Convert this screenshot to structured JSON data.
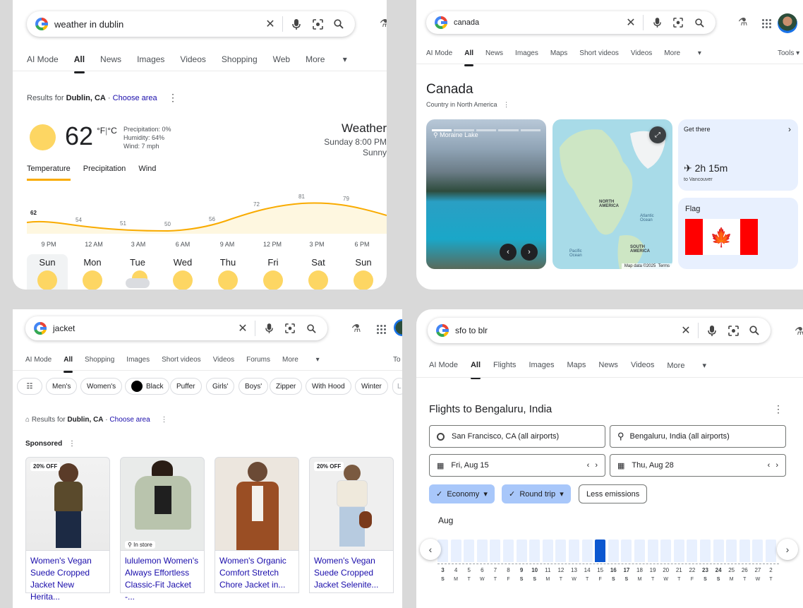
{
  "common": {
    "ai_mode": "AI Mode",
    "all": "All",
    "more": "More",
    "results_for": "Results for",
    "choose_area": "Choose area"
  },
  "weather": {
    "query": "weather in dublin",
    "tabs": [
      "News",
      "Images",
      "Videos",
      "Shopping",
      "Web"
    ],
    "location": "Dublin, CA",
    "temp": "62",
    "unit_f": "°F",
    "unit_sep": "|",
    "unit_c": "°C",
    "precipitation": "Precipitation: 0%",
    "humidity": "Humidity: 64%",
    "wind": "Wind: 7 mph",
    "heading": "Weather",
    "datetime": "Sunday 8:00 PM",
    "condition": "Sunny",
    "subtabs": [
      "Temperature",
      "Precipitation",
      "Wind"
    ],
    "hourly_temps": [
      "62",
      "54",
      "51",
      "50",
      "56",
      "72",
      "81",
      "79"
    ],
    "hours": [
      "9 PM",
      "12 AM",
      "3 AM",
      "6 AM",
      "9 AM",
      "12 PM",
      "3 PM",
      "6 PM"
    ],
    "days": [
      "Sun",
      "Mon",
      "Tue",
      "Wed",
      "Thu",
      "Fri",
      "Sat",
      "Sun"
    ],
    "colors": {
      "sun": "#fdd663",
      "line": "#f9ab00",
      "fill": "#fef7e0"
    }
  },
  "canada": {
    "query": "canada",
    "tabs": [
      "News",
      "Images",
      "Maps",
      "Short videos",
      "Videos"
    ],
    "tools": "Tools",
    "title": "Canada",
    "subtitle": "Country in North America",
    "photo_caption": "Moraine Lake",
    "map_labels": {
      "north_america": "NORTH AMERICA",
      "atlantic": "Atlantic Ocean",
      "pacific": "Pacific Ocean",
      "south_america": "SOUTH AMERICA",
      "map_data": "Map data ©2025",
      "terms": "Terms"
    },
    "get_there": "Get there",
    "flight_time": "2h 15m",
    "flight_dest": "to Vancouver",
    "flag_label": "Flag"
  },
  "jacket": {
    "query": "jacket",
    "tabs": [
      "Shopping",
      "Images",
      "Short videos",
      "Videos",
      "Forums"
    ],
    "tools_partial": "To",
    "chips": [
      "Men's",
      "Women's",
      "Black",
      "Puffer",
      "Girls'",
      "Boys'",
      "Zipper",
      "With Hood",
      "Winter",
      "L"
    ],
    "sponsored": "Sponsored",
    "products": [
      {
        "badge": "20% OFF",
        "title": "Women's Vegan Suede Cropped Jacket New Herita...",
        "store": ""
      },
      {
        "badge": "",
        "title": "lululemon Women's Always Effortless Classic-Fit Jacket -...",
        "store": "In store"
      },
      {
        "badge": "",
        "title": "Women's Organic Comfort Stretch Chore Jacket in...",
        "store": ""
      },
      {
        "badge": "20% OFF",
        "title": "Women's Vegan Suede Cropped Jacket Selenite...",
        "store": ""
      }
    ]
  },
  "flights": {
    "query": "sfo to blr",
    "tabs": [
      "Flights",
      "Images",
      "Maps",
      "News",
      "Videos"
    ],
    "title": "Flights to Bengaluru, India",
    "origin": "San Francisco, CA (all airports)",
    "destination": "Bengaluru, India (all airports)",
    "depart": "Fri, Aug 15",
    "return": "Thu, Aug 28",
    "economy": "Economy",
    "round_trip": "Round trip",
    "less_emissions": "Less emissions",
    "month": "Aug",
    "dates": [
      "3",
      "4",
      "5",
      "6",
      "7",
      "8",
      "9",
      "10",
      "11",
      "12",
      "13",
      "14",
      "15",
      "16",
      "17",
      "18",
      "19",
      "20",
      "21",
      "22",
      "23",
      "24",
      "25",
      "26",
      "27",
      "2"
    ],
    "weekdays": [
      "S",
      "M",
      "T",
      "W",
      "T",
      "F",
      "S",
      "S",
      "M",
      "T",
      "W",
      "T",
      "F",
      "S",
      "S",
      "M",
      "T",
      "W",
      "T",
      "F",
      "S",
      "S",
      "M",
      "T",
      "W",
      "T"
    ],
    "bold_dates": [
      "3",
      "9",
      "10",
      "16",
      "17",
      "23",
      "24"
    ],
    "selected_date": "15",
    "colors": {
      "pill": "#a8c7fa",
      "bar": "#e8f0fe",
      "selected": "#0b57d0"
    }
  }
}
